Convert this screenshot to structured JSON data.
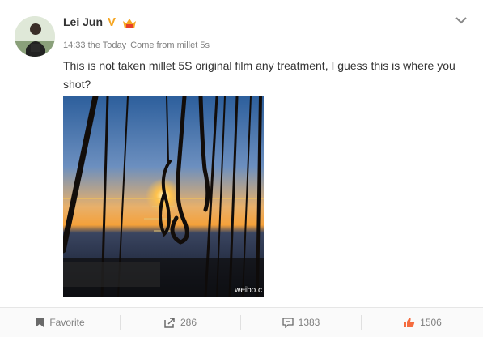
{
  "post": {
    "author": "Lei Jun",
    "verified_mark": "V",
    "time": "14:33 the Today",
    "source": "Come from millet 5s",
    "text": "This is not taken millet 5S original film any treatment, I guess this is where you shot?",
    "image_watermark": "weibo.c"
  },
  "actions": {
    "favorite_label": "Favorite",
    "forward_count": "286",
    "comment_count": "1383",
    "like_count": "1506"
  },
  "colors": {
    "verified": "#f5a623",
    "like_icon": "#f56c3f",
    "muted_text": "#808080"
  },
  "icons": [
    "avatar",
    "verified-v-icon",
    "member-badge-icon",
    "chevron-down-icon",
    "bookmark-icon",
    "forward-icon",
    "comment-icon",
    "thumbs-up-icon"
  ]
}
